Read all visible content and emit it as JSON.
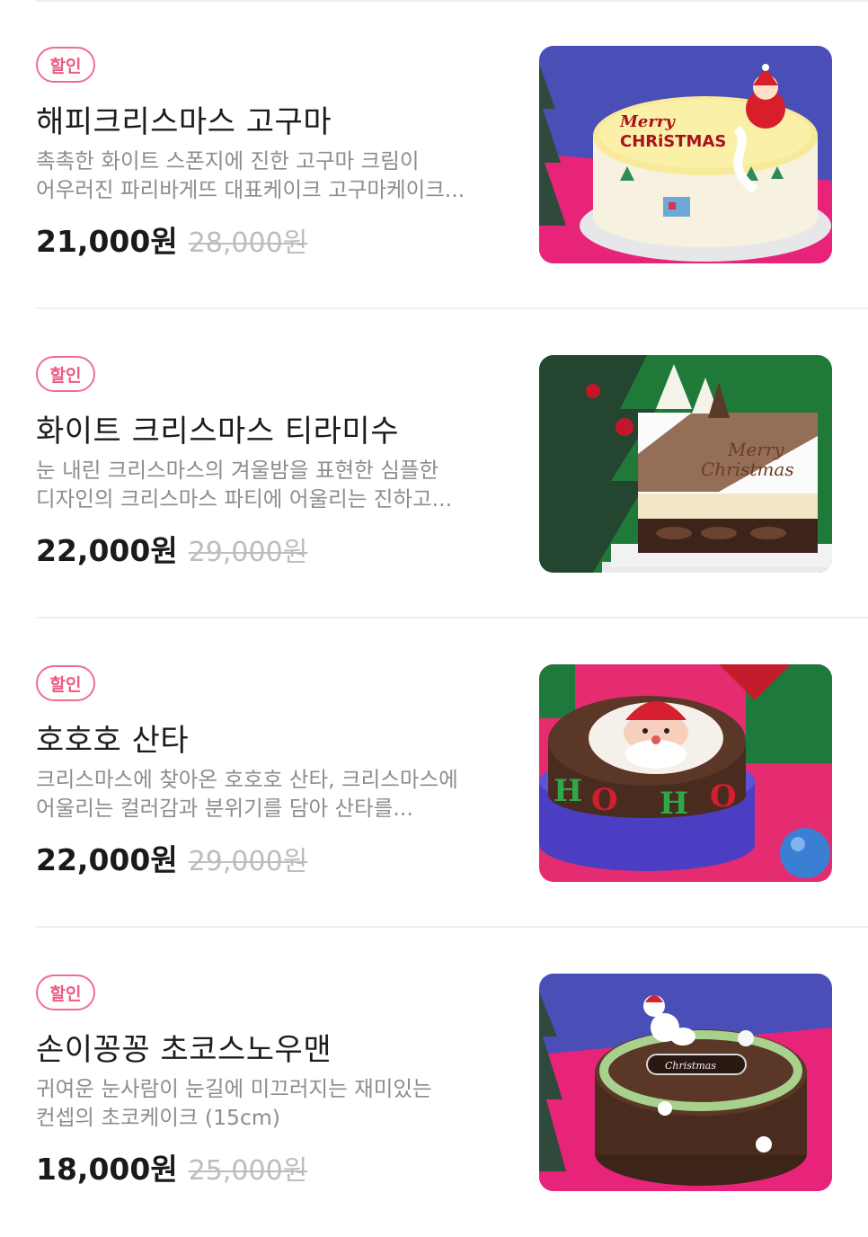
{
  "products": [
    {
      "badge": "할인",
      "name": "해피크리스마스 고구마",
      "desc_line1": "촉촉한 화이트 스폰지에 진한 고구마 크림이",
      "desc_line2": "어우러진 파리바게뜨 대표케이크 고구마케이크...",
      "price": "21,000원",
      "original_price": "28,000원",
      "image_text": "Merry CHRISTMAS"
    },
    {
      "badge": "할인",
      "name": "화이트 크리스마스 티라미수",
      "desc_line1": "눈 내린 크리스마스의 겨울밤을 표현한 심플한",
      "desc_line2": "디자인의 크리스마스 파티에 어울리는 진하고...",
      "price": "22,000원",
      "original_price": "29,000원",
      "image_text": "Merry Christmas"
    },
    {
      "badge": "할인",
      "name": "호호호 산타",
      "desc_line1": "크리스마스에 찾아온 호호호 산타, 크리스마스에",
      "desc_line2": "어울리는 컬러감과 분위기를 담아 산타를...",
      "price": "22,000원",
      "original_price": "29,000원",
      "image_text": "HOHO"
    },
    {
      "badge": "할인",
      "name": "손이꽁꽁 초코스노우맨",
      "desc_line1": "귀여운 눈사람이 눈길에 미끄러지는 재미있는",
      "desc_line2": "컨셉의 초코케이크  (15cm)",
      "price": "18,000원",
      "original_price": "25,000원",
      "image_text": "Christmas"
    }
  ],
  "colors": {
    "badge": "#ee5a82",
    "price": "#1a1a1a",
    "original_price": "#bdbdbd",
    "description": "#8d8d8d"
  }
}
